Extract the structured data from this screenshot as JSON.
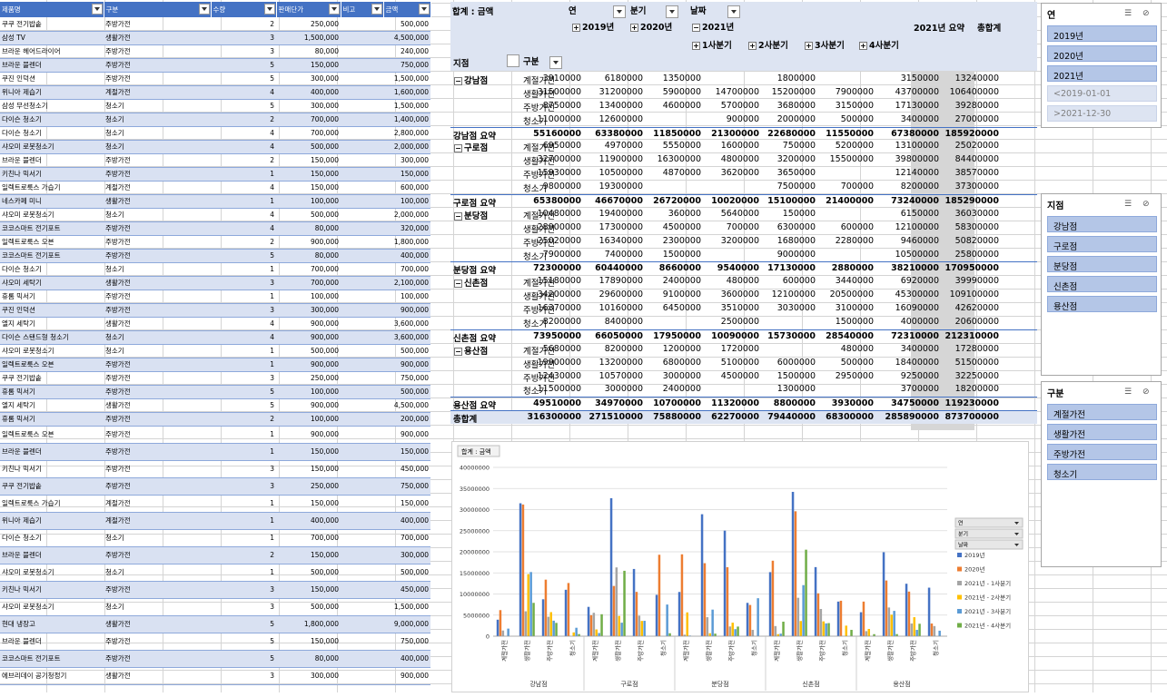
{
  "left_table": {
    "headers": [
      "제품명",
      "구분",
      "수량",
      "판매단가",
      "비고",
      "금액"
    ],
    "rows": [
      [
        "쿠쿠 전기밥솥",
        "주방가전",
        "2",
        "250,000",
        "",
        "500,000"
      ],
      [
        "삼성 TV",
        "생활가전",
        "3",
        "1,500,000",
        "",
        "4,500,000"
      ],
      [
        "브라운 헤어드라이어",
        "주방가전",
        "3",
        "80,000",
        "",
        "240,000"
      ],
      [
        "브라운 블렌더",
        "주방가전",
        "5",
        "150,000",
        "",
        "750,000"
      ],
      [
        "쿠진 인덕션",
        "주방가전",
        "5",
        "300,000",
        "",
        "1,500,000"
      ],
      [
        "위니아 제습기",
        "계절가전",
        "4",
        "400,000",
        "",
        "1,600,000"
      ],
      [
        "삼성 무선청소기",
        "청소기",
        "5",
        "300,000",
        "",
        "1,500,000"
      ],
      [
        "다이슨 청소기",
        "청소기",
        "2",
        "700,000",
        "",
        "1,400,000"
      ],
      [
        "다이슨 청소기",
        "청소기",
        "4",
        "700,000",
        "",
        "2,800,000"
      ],
      [
        "샤오미 로봇청소기",
        "청소기",
        "4",
        "500,000",
        "",
        "2,000,000"
      ],
      [
        "브라운 블렌더",
        "주방가전",
        "2",
        "150,000",
        "",
        "300,000"
      ],
      [
        "키친나 믹서기",
        "주방가전",
        "1",
        "150,000",
        "",
        "150,000"
      ],
      [
        "일렉트로룩스 가습기",
        "계절가전",
        "4",
        "150,000",
        "",
        "600,000"
      ],
      [
        "네스카페 미니",
        "생활가전",
        "1",
        "100,000",
        "",
        "100,000"
      ],
      [
        "샤오미 로봇청소기",
        "청소기",
        "4",
        "500,000",
        "",
        "2,000,000"
      ],
      [
        "코코스마트 전기포트",
        "주방가전",
        "4",
        "80,000",
        "",
        "320,000"
      ],
      [
        "일렉트로룩스 오븐",
        "주방가전",
        "2",
        "900,000",
        "",
        "1,800,000"
      ],
      [
        "코코스마트 전기포트",
        "주방가전",
        "5",
        "80,000",
        "",
        "400,000"
      ],
      [
        "다이슨 청소기",
        "청소기",
        "1",
        "700,000",
        "",
        "700,000"
      ],
      [
        "샤오미 세탁기",
        "생활가전",
        "3",
        "700,000",
        "",
        "2,100,000"
      ],
      [
        "휴롬 믹서기",
        "주방가전",
        "1",
        "100,000",
        "",
        "100,000"
      ],
      [
        "쿠진 인덕션",
        "주방가전",
        "3",
        "300,000",
        "",
        "900,000"
      ],
      [
        "엘지 세탁기",
        "생활가전",
        "4",
        "900,000",
        "",
        "3,600,000"
      ],
      [
        "다이슨 스탠드형 청소기",
        "청소기",
        "4",
        "900,000",
        "",
        "3,600,000"
      ],
      [
        "샤오미 로봇청소기",
        "청소기",
        "1",
        "500,000",
        "",
        "500,000"
      ],
      [
        "일렉트로룩스 오븐",
        "주방가전",
        "1",
        "900,000",
        "",
        "900,000"
      ],
      [
        "쿠쿠 전기밥솥",
        "주방가전",
        "3",
        "250,000",
        "",
        "750,000"
      ],
      [
        "휴롬 믹서기",
        "주방가전",
        "5",
        "100,000",
        "",
        "500,000"
      ],
      [
        "엘지 세탁기",
        "생활가전",
        "5",
        "900,000",
        "",
        "4,500,000"
      ],
      [
        "휴롬 믹서기",
        "주방가전",
        "2",
        "100,000",
        "",
        "200,000"
      ],
      [
        "일렉트로룩스 오븐",
        "주방가전",
        "1",
        "900,000",
        "",
        "900,000"
      ],
      [
        "브라운 블렌더",
        "주방가전",
        "1",
        "150,000",
        "",
        "150,000"
      ],
      [
        "키친나 믹서기",
        "주방가전",
        "3",
        "150,000",
        "",
        "450,000"
      ],
      [
        "쿠쿠 전기밥솥",
        "주방가전",
        "3",
        "250,000",
        "",
        "750,000"
      ],
      [
        "일렉트로룩스 가습기",
        "계절가전",
        "1",
        "150,000",
        "",
        "150,000"
      ],
      [
        "위니아 제습기",
        "계절가전",
        "1",
        "400,000",
        "",
        "400,000"
      ],
      [
        "다이슨 청소기",
        "청소기",
        "1",
        "700,000",
        "",
        "700,000"
      ],
      [
        "브라운 블렌더",
        "주방가전",
        "2",
        "150,000",
        "",
        "300,000"
      ],
      [
        "샤오미 로봇청소기",
        "청소기",
        "1",
        "500,000",
        "",
        "500,000"
      ],
      [
        "키친나 믹서기",
        "주방가전",
        "3",
        "150,000",
        "",
        "450,000"
      ],
      [
        "샤오미 로봇청소기",
        "청소기",
        "3",
        "500,000",
        "",
        "1,500,000"
      ],
      [
        "현대 냉장고",
        "생활가전",
        "5",
        "1,800,000",
        "",
        "9,000,000"
      ],
      [
        "브라운 블렌더",
        "주방가전",
        "5",
        "150,000",
        "",
        "750,000"
      ],
      [
        "코코스마트 전기포트",
        "주방가전",
        "5",
        "80,000",
        "",
        "400,000"
      ],
      [
        "에브리데이 공기청정기",
        "생활가전",
        "3",
        "300,000",
        "",
        "900,000"
      ]
    ]
  },
  "pivot": {
    "sum_label": "합계 : 금액",
    "field_year": "연",
    "field_quarter": "분기",
    "field_date": "날짜",
    "col_2019": "2019년",
    "col_2020": "2020년",
    "col_2021": "2021년",
    "q1": "1사분기",
    "q2": "2사분기",
    "q3": "3사분기",
    "q4": "4사분기",
    "sub_2021": "2021년 요약",
    "grand_col": "총합계",
    "row_field_branch": "지점",
    "row_field_cat": "구분",
    "grand_row": "총합계",
    "grand_values": [
      "316300000",
      "271510000",
      "75880000",
      "62270000",
      "79440000",
      "68300000",
      "285890000",
      "873700000"
    ],
    "branches": [
      {
        "name": "강남점",
        "summary": "강남점 요약",
        "summary_values": [
          "55160000",
          "63380000",
          "11850000",
          "21300000",
          "22680000",
          "11550000",
          "67380000",
          "185920000"
        ],
        "rows": [
          {
            "cat": "계절가전",
            "v": [
              "3910000",
              "6180000",
              "1350000",
              "",
              "1800000",
              "",
              "3150000",
              "13240000"
            ]
          },
          {
            "cat": "생활가전",
            "v": [
              "31500000",
              "31200000",
              "5900000",
              "14700000",
              "15200000",
              "7900000",
              "43700000",
              "106400000"
            ]
          },
          {
            "cat": "주방가전",
            "v": [
              "8750000",
              "13400000",
              "4600000",
              "5700000",
              "3680000",
              "3150000",
              "17130000",
              "39280000"
            ]
          },
          {
            "cat": "청소기",
            "v": [
              "11000000",
              "12600000",
              "",
              "900000",
              "2000000",
              "500000",
              "3400000",
              "27000000"
            ]
          }
        ]
      },
      {
        "name": "구로점",
        "summary": "구로점 요약",
        "summary_values": [
          "65380000",
          "46670000",
          "26720000",
          "10020000",
          "15100000",
          "21400000",
          "73240000",
          "185290000"
        ],
        "rows": [
          {
            "cat": "계절가전",
            "v": [
              "6950000",
              "4970000",
              "5550000",
              "1600000",
              "750000",
              "5200000",
              "13100000",
              "25020000"
            ]
          },
          {
            "cat": "생활가전",
            "v": [
              "32700000",
              "11900000",
              "16300000",
              "4800000",
              "3200000",
              "15500000",
              "39800000",
              "84400000"
            ]
          },
          {
            "cat": "주방가전",
            "v": [
              "15930000",
              "10500000",
              "4870000",
              "3620000",
              "3650000",
              "",
              "12140000",
              "38570000"
            ]
          },
          {
            "cat": "청소기",
            "v": [
              "9800000",
              "19300000",
              "",
              "",
              "7500000",
              "700000",
              "8200000",
              "37300000"
            ]
          }
        ]
      },
      {
        "name": "분당점",
        "summary": "분당점 요약",
        "summary_values": [
          "72300000",
          "60440000",
          "8660000",
          "9540000",
          "17130000",
          "2880000",
          "38210000",
          "170950000"
        ],
        "rows": [
          {
            "cat": "계절가전",
            "v": [
              "10480000",
              "19400000",
              "360000",
              "5640000",
              "150000",
              "",
              "6150000",
              "36030000"
            ]
          },
          {
            "cat": "생활가전",
            "v": [
              "28900000",
              "17300000",
              "4500000",
              "700000",
              "6300000",
              "600000",
              "12100000",
              "58300000"
            ]
          },
          {
            "cat": "주방가전",
            "v": [
              "25020000",
              "16340000",
              "2300000",
              "3200000",
              "1680000",
              "2280000",
              "9460000",
              "50820000"
            ]
          },
          {
            "cat": "청소기",
            "v": [
              "7900000",
              "7400000",
              "1500000",
              "",
              "9000000",
              "",
              "10500000",
              "25800000"
            ]
          }
        ]
      },
      {
        "name": "신촌점",
        "summary": "신촌점 요약",
        "summary_values": [
          "73950000",
          "66050000",
          "17950000",
          "10090000",
          "15730000",
          "28540000",
          "72310000",
          "212310000"
        ],
        "rows": [
          {
            "cat": "계절가전",
            "v": [
              "15180000",
              "17890000",
              "2400000",
              "480000",
              "600000",
              "3440000",
              "6920000",
              "39990000"
            ]
          },
          {
            "cat": "생활가전",
            "v": [
              "34200000",
              "29600000",
              "9100000",
              "3600000",
              "12100000",
              "20500000",
              "45300000",
              "109100000"
            ]
          },
          {
            "cat": "주방가전",
            "v": [
              "16370000",
              "10160000",
              "6450000",
              "3510000",
              "3030000",
              "3100000",
              "16090000",
              "42620000"
            ]
          },
          {
            "cat": "청소기",
            "v": [
              "8200000",
              "8400000",
              "",
              "2500000",
              "",
              "1500000",
              "4000000",
              "20600000"
            ]
          }
        ]
      },
      {
        "name": "용산점",
        "summary": "용산점 요약",
        "summary_values": [
          "49510000",
          "34970000",
          "10700000",
          "11320000",
          "8800000",
          "3930000",
          "34750000",
          "119230000"
        ],
        "rows": [
          {
            "cat": "계절가전",
            "v": [
              "5680000",
              "8200000",
              "1200000",
              "1720000",
              "",
              "480000",
              "3400000",
              "17280000"
            ]
          },
          {
            "cat": "생활가전",
            "v": [
              "19900000",
              "13200000",
              "6800000",
              "5100000",
              "6000000",
              "500000",
              "18400000",
              "51500000"
            ]
          },
          {
            "cat": "주방가전",
            "v": [
              "12430000",
              "10570000",
              "3000000",
              "4500000",
              "1500000",
              "2950000",
              "9250000",
              "32250000"
            ]
          },
          {
            "cat": "청소기",
            "v": [
              "11500000",
              "3000000",
              "2400000",
              "",
              "1300000",
              "",
              "3700000",
              "18200000"
            ]
          }
        ]
      }
    ]
  },
  "chart_data": {
    "type": "bar",
    "title": "",
    "tag": "합계 : 금액",
    "yticks": [
      "0",
      "5000000",
      "10000000",
      "15000000",
      "20000000",
      "25000000",
      "30000000",
      "35000000",
      "40000000"
    ],
    "ylim": [
      0,
      40000000
    ],
    "groups": [
      "강남점",
      "구로점",
      "분당점",
      "신촌점",
      "용산점"
    ],
    "categories": [
      "계절가전",
      "생활가전",
      "주방가전",
      "청소기"
    ],
    "legend_filters": [
      "연",
      "분기",
      "날짜"
    ],
    "series": [
      {
        "name": "2019년",
        "color": "#4472c4",
        "values": [
          3910000,
          31500000,
          8750000,
          11000000,
          6950000,
          32700000,
          15930000,
          9800000,
          10480000,
          28900000,
          25020000,
          7900000,
          15180000,
          34200000,
          16370000,
          8200000,
          5680000,
          19900000,
          12430000,
          11500000
        ]
      },
      {
        "name": "2020년",
        "color": "#ed7d31",
        "values": [
          6180000,
          31200000,
          13400000,
          12600000,
          4970000,
          11900000,
          10500000,
          19300000,
          19400000,
          17300000,
          16340000,
          7400000,
          17890000,
          29600000,
          10160000,
          8400000,
          8200000,
          13200000,
          10570000,
          3000000
        ]
      },
      {
        "name": "2021년 - 1사분기",
        "color": "#a5a5a5",
        "values": [
          1350000,
          5900000,
          4600000,
          0,
          5550000,
          16300000,
          4870000,
          0,
          360000,
          4500000,
          2300000,
          1500000,
          2400000,
          9100000,
          6450000,
          0,
          1200000,
          6800000,
          3000000,
          2400000
        ]
      },
      {
        "name": "2021년 - 2사분기",
        "color": "#ffc000",
        "values": [
          0,
          14700000,
          5700000,
          900000,
          1600000,
          4800000,
          3620000,
          0,
          5640000,
          700000,
          3200000,
          0,
          480000,
          3600000,
          3510000,
          2500000,
          1720000,
          5100000,
          4500000,
          0
        ]
      },
      {
        "name": "2021년 - 3사분기",
        "color": "#5b9bd5",
        "values": [
          1800000,
          15200000,
          3680000,
          2000000,
          750000,
          3200000,
          3650000,
          7500000,
          150000,
          6300000,
          1680000,
          9000000,
          600000,
          12100000,
          3030000,
          0,
          0,
          6000000,
          1500000,
          1300000
        ]
      },
      {
        "name": "2021년 - 4사분기",
        "color": "#70ad47",
        "values": [
          0,
          7900000,
          3150000,
          500000,
          5200000,
          15500000,
          0,
          700000,
          0,
          600000,
          2280000,
          0,
          3440000,
          20500000,
          3100000,
          1500000,
          480000,
          500000,
          2950000,
          0
        ]
      }
    ]
  },
  "slicers": {
    "year": {
      "title": "연",
      "items": [
        {
          "label": "2019년",
          "on": true
        },
        {
          "label": "2020년",
          "on": true
        },
        {
          "label": "2021년",
          "on": true
        },
        {
          "label": "<2019-01-01",
          "on": false
        },
        {
          "label": ">2021-12-30",
          "on": false
        }
      ]
    },
    "branch": {
      "title": "지점",
      "items": [
        {
          "label": "강남점",
          "on": true
        },
        {
          "label": "구로점",
          "on": true
        },
        {
          "label": "분당점",
          "on": true
        },
        {
          "label": "신촌점",
          "on": true
        },
        {
          "label": "용산점",
          "on": true
        }
      ]
    },
    "category": {
      "title": "구분",
      "items": [
        {
          "label": "계절가전",
          "on": true
        },
        {
          "label": "생활가전",
          "on": true
        },
        {
          "label": "주방가전",
          "on": true
        },
        {
          "label": "청소기",
          "on": true
        }
      ]
    }
  }
}
